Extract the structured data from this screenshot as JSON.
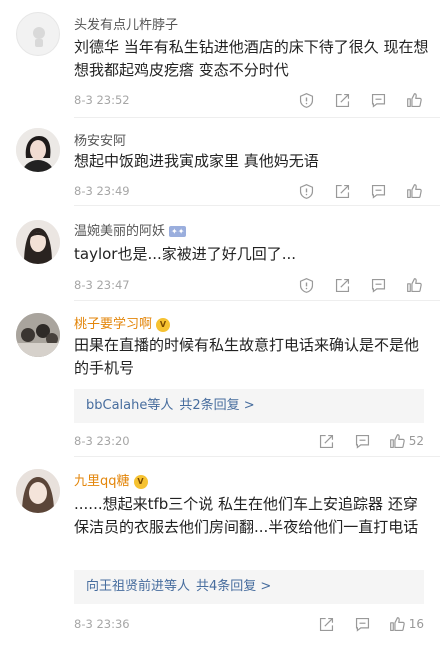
{
  "colors": {
    "name_gold": "#e3860b",
    "reply_link": "#476d9e",
    "time_gray": "#a6a6a6"
  },
  "icons": [
    "report-icon",
    "share-icon",
    "comment-icon",
    "like-icon"
  ],
  "comments": [
    {
      "name": "头发有点儿杵脖子",
      "text": "刘德华 当年有私生钻进他酒店的床下待了很久 现在想想我都起鸡皮疙瘩 变态不分时代",
      "time": "8-3 23:52"
    },
    {
      "name": "杨安安阿",
      "text": "想起中饭跑进我寅成家里 真他妈无语",
      "time": "8-3 23:49"
    },
    {
      "name": "温婉美丽的阿妖",
      "text": "taylor也是...家被进了好几回了...",
      "time": "8-3 23:47"
    },
    {
      "name": "桃子要学习啊",
      "text": "田果在直播的时候有私生故意打电话来确认是不是他的手机号",
      "replies_text": "bbCalahe等人",
      "replies_count": "共2条回复 >",
      "time": "8-3 23:20",
      "likes": "52"
    },
    {
      "name": "九里qq糖",
      "text": "......想起来tfb三个说 私生在他们车上安追踪器 还穿保洁员的衣服去他们房间翻...半夜给他们一直打电话",
      "replies_text": "向王祖贤前进等人",
      "replies_count": "共4条回复 >",
      "time": "8-3 23:36",
      "likes": "16"
    }
  ]
}
